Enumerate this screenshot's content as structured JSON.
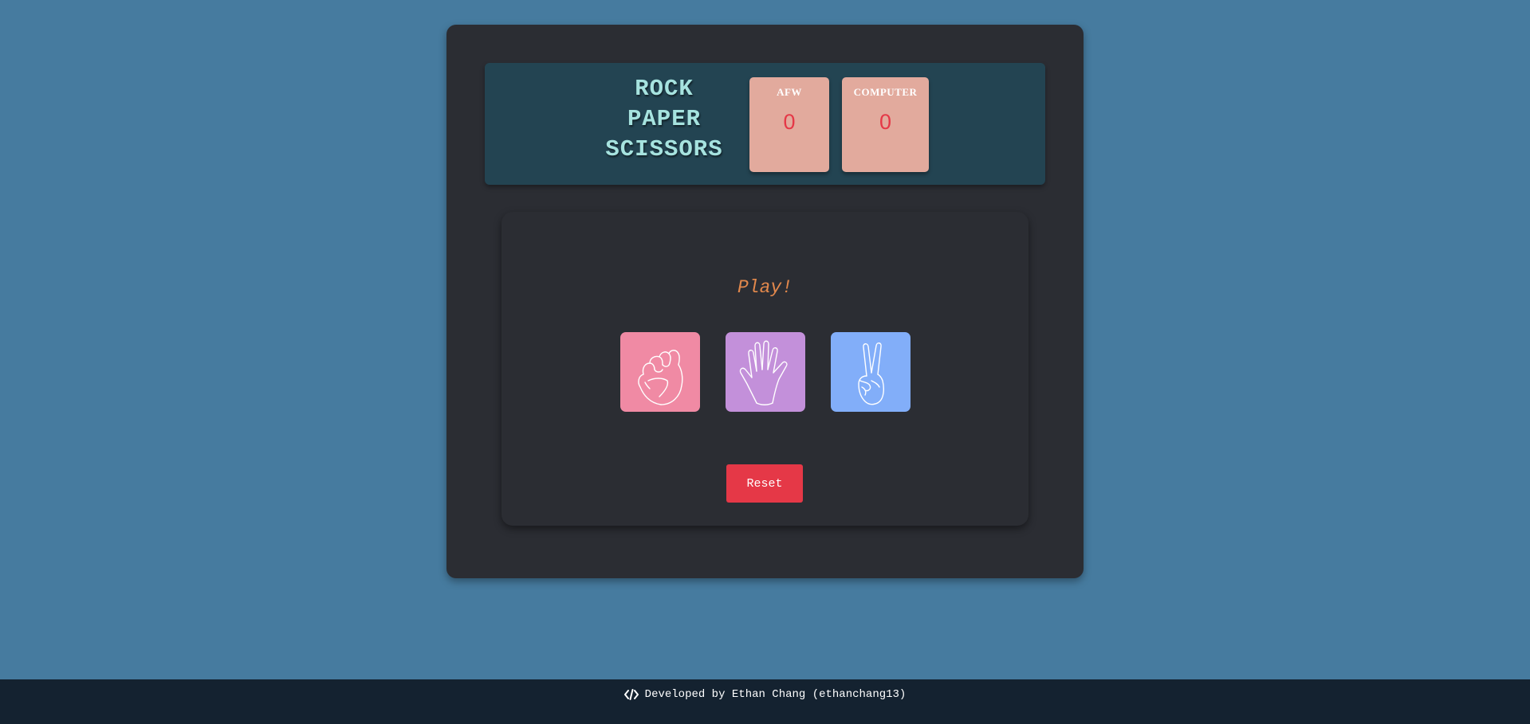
{
  "scoreboard": {
    "title_lines": [
      "ROCK",
      "PAPER",
      "SCISSORS"
    ],
    "player": {
      "name": "AFW",
      "score": "0"
    },
    "computer": {
      "name": "COMPUTER",
      "score": "0"
    }
  },
  "game": {
    "status": "Play!",
    "choices": [
      {
        "id": "rock",
        "icon": "fist-icon",
        "color": "#f08aa4"
      },
      {
        "id": "paper",
        "icon": "open-hand-icon",
        "color": "#c390da"
      },
      {
        "id": "scissors",
        "icon": "peace-hand-icon",
        "color": "#82aef9"
      }
    ],
    "reset_label": "Reset"
  },
  "footer": {
    "icon": "code-icon",
    "text": "Developed by Ethan Chang (ethanchang13)"
  },
  "colors": {
    "background": "#467b9f",
    "panel": "#2b2d33",
    "scoreboard": "#234452",
    "score_card": "#e2aa9d",
    "score_value": "#e53847",
    "status": "#e2884c",
    "reset": "#e53847",
    "footer": "#142230"
  }
}
